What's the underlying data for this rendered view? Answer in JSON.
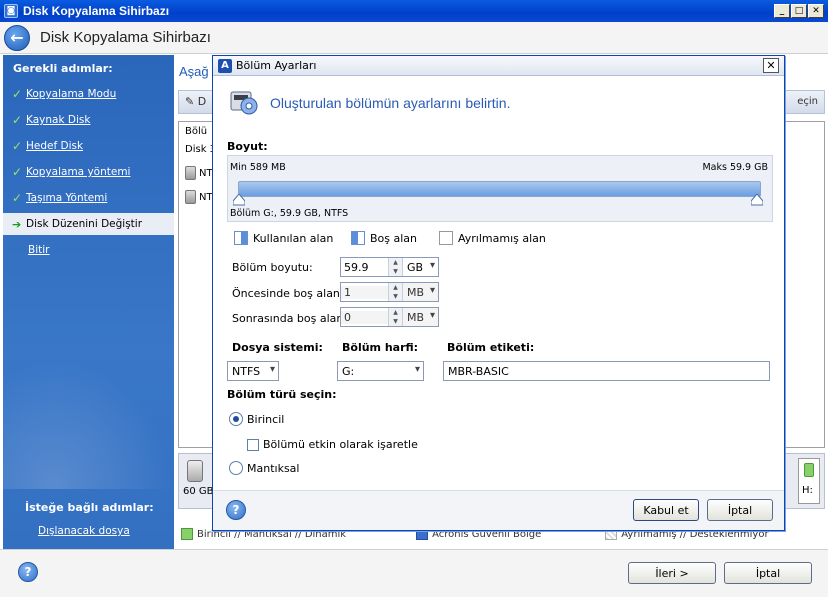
{
  "window": {
    "title": "Disk Kopyalama Sihirbazı",
    "header_title": "Disk Kopyalama Sihirbazı"
  },
  "sidebar": {
    "heading": "Gerekli adımlar:",
    "items": [
      {
        "label": "Kopyalama Modu",
        "done": true
      },
      {
        "label": "Kaynak Disk",
        "done": true
      },
      {
        "label": "Hedef Disk",
        "done": true
      },
      {
        "label": "Kopyalama yöntemi",
        "done": true
      },
      {
        "label": "Taşıma Yöntemi",
        "done": true
      },
      {
        "label": "Disk Düzenini Değiştir",
        "active": true
      },
      {
        "label": "Bitir"
      }
    ],
    "optional_heading": "İsteğe bağlı adımlar:",
    "optional_link": "Dışlanacak dosya"
  },
  "main": {
    "partial_title": "Aşağ",
    "toolbar_left": "D",
    "toolbar_right": "eçin",
    "table_col": "Bölü",
    "table_row": "Disk 3",
    "row_a": "NT",
    "row_b": "NT",
    "disk_size": "60 GB",
    "h_label": "H:",
    "legend": [
      {
        "label": "Birincil // Mantıksal // Dinamik",
        "color": "#8ad06a"
      },
      {
        "label": "Acronis Güvenli Bölge",
        "color": "#3a6fd0"
      },
      {
        "label": "Ayrılmamış // Desteklenmiyor",
        "color": "#d8d8d8"
      }
    ]
  },
  "footer": {
    "next_label": "İleri >",
    "cancel_label": "İptal"
  },
  "dialog": {
    "title": "Bölüm Ayarları",
    "heading": "Oluşturulan bölümün ayarlarını belirtin.",
    "size_label": "Boyut:",
    "min_label": "Min 589 MB",
    "max_label": "Maks 59.9 GB",
    "partition_info": "Bölüm G:, 59.9 GB, NTFS",
    "legend": {
      "used": "Kullanılan alan",
      "free": "Boş alan",
      "unallocated": "Ayrılmamış alan"
    },
    "fields": {
      "partition_size": {
        "label": "Bölüm boyutu:",
        "value": "59.9",
        "unit": "GB"
      },
      "free_before": {
        "label": "Öncesinde boş alan:",
        "value": "1",
        "unit": "MB"
      },
      "free_after": {
        "label": "Sonrasında boş alan:",
        "value": "0",
        "unit": "MB"
      }
    },
    "filesystem_label": "Dosya sistemi:",
    "filesystem_value": "NTFS",
    "letter_label": "Bölüm harfi:",
    "letter_value": "G:",
    "volume_label_label": "Bölüm etiketi:",
    "volume_label_value": "MBR-BASIC",
    "type_label": "Bölüm türü seçin:",
    "primary_label": "Birincil",
    "active_label": "Bölümü etkin olarak işaretle",
    "logical_label": "Mantıksal",
    "ok_label": "Kabul et",
    "cancel_label": "İptal"
  }
}
